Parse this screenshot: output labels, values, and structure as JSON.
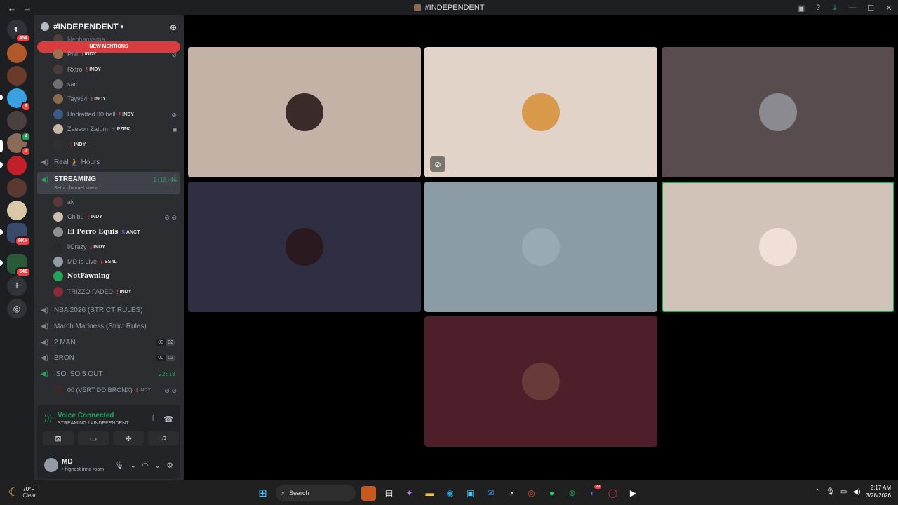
{
  "window": {
    "title": "#INDEPENDENT"
  },
  "guilds": {
    "home_badge": "454",
    "badges": [
      "9",
      "4",
      "2",
      "9K+",
      "546"
    ]
  },
  "server": {
    "name": "#INDEPENDENT",
    "new_mentions": "NEW MENTIONS"
  },
  "members_top": [
    {
      "name": "Nenbanyama",
      "tag": ""
    },
    {
      "name": "Phil",
      "tag": "INDY"
    },
    {
      "name": "Rxtro",
      "tag": "INDY"
    },
    {
      "name": "sac",
      "tag": ""
    },
    {
      "name": "Tayy64",
      "tag": "INDY"
    },
    {
      "name": "Undrafted 30 ball",
      "tag": "INDY"
    },
    {
      "name": "Zaeson Zatum",
      "tag": "PZPK"
    },
    {
      "name": "",
      "tag": "INDY"
    }
  ],
  "channels": {
    "real_hours": "Real 🧎 Hours",
    "streaming": {
      "name": "STREAMING",
      "status": "Set a channel status",
      "time": "1:15:46"
    },
    "nba": "NBA 2026 (STRICT RULES)",
    "march": "March Madness (Strict Rules)",
    "two_man": {
      "name": "2 MAN",
      "left": "00",
      "right": "02"
    },
    "bron": {
      "name": "BRON",
      "left": "00",
      "right": "02"
    },
    "iso": {
      "name": "ISO ISO 5 OUT",
      "time": "22:18"
    }
  },
  "members_stream": [
    {
      "name": "ak",
      "tag": ""
    },
    {
      "name": "Chibu",
      "tag": "INDY"
    },
    {
      "name": "El Perro Equis",
      "tag": "ANCT"
    },
    {
      "name": "iiCrazy",
      "tag": "INDY"
    },
    {
      "name": "MD is Live",
      "tag": "SS4L"
    },
    {
      "name": "NotFawning",
      "tag": ""
    },
    {
      "name": "TRIZZO FADED",
      "tag": "INDY"
    }
  ],
  "iso_member": {
    "name": "00 (VERT DO BRONX)",
    "tag": "INDY"
  },
  "voice": {
    "connected": "Voice Connected",
    "location": "STREAMING / #INDEPENDENT"
  },
  "user": {
    "name": "MD",
    "status": "• highest inna room"
  },
  "taskbar": {
    "temp": "70°F",
    "condition": "Clear",
    "search": "Search",
    "time": "2:17 AM",
    "date": "3/28/2026",
    "discord_badge": "99"
  },
  "colors": {
    "tiles": [
      "#c5b2a6",
      "#e2d3c8",
      "#584c4e",
      "#302e42",
      "#8c9ca6",
      "#d2c3b8",
      "#4e1e2a"
    ],
    "accent_green": "#23a55a",
    "mention_red": "#d83c3e"
  },
  "icons": [
    "back-arrow",
    "forward-arrow",
    "discord-logo",
    "add-member",
    "speaker",
    "muted-mic",
    "camera",
    "signal",
    "phone-hangup",
    "camera-off",
    "screen-share",
    "activities",
    "soundboard",
    "microphone",
    "headphones",
    "gear",
    "windows-start",
    "search"
  ]
}
